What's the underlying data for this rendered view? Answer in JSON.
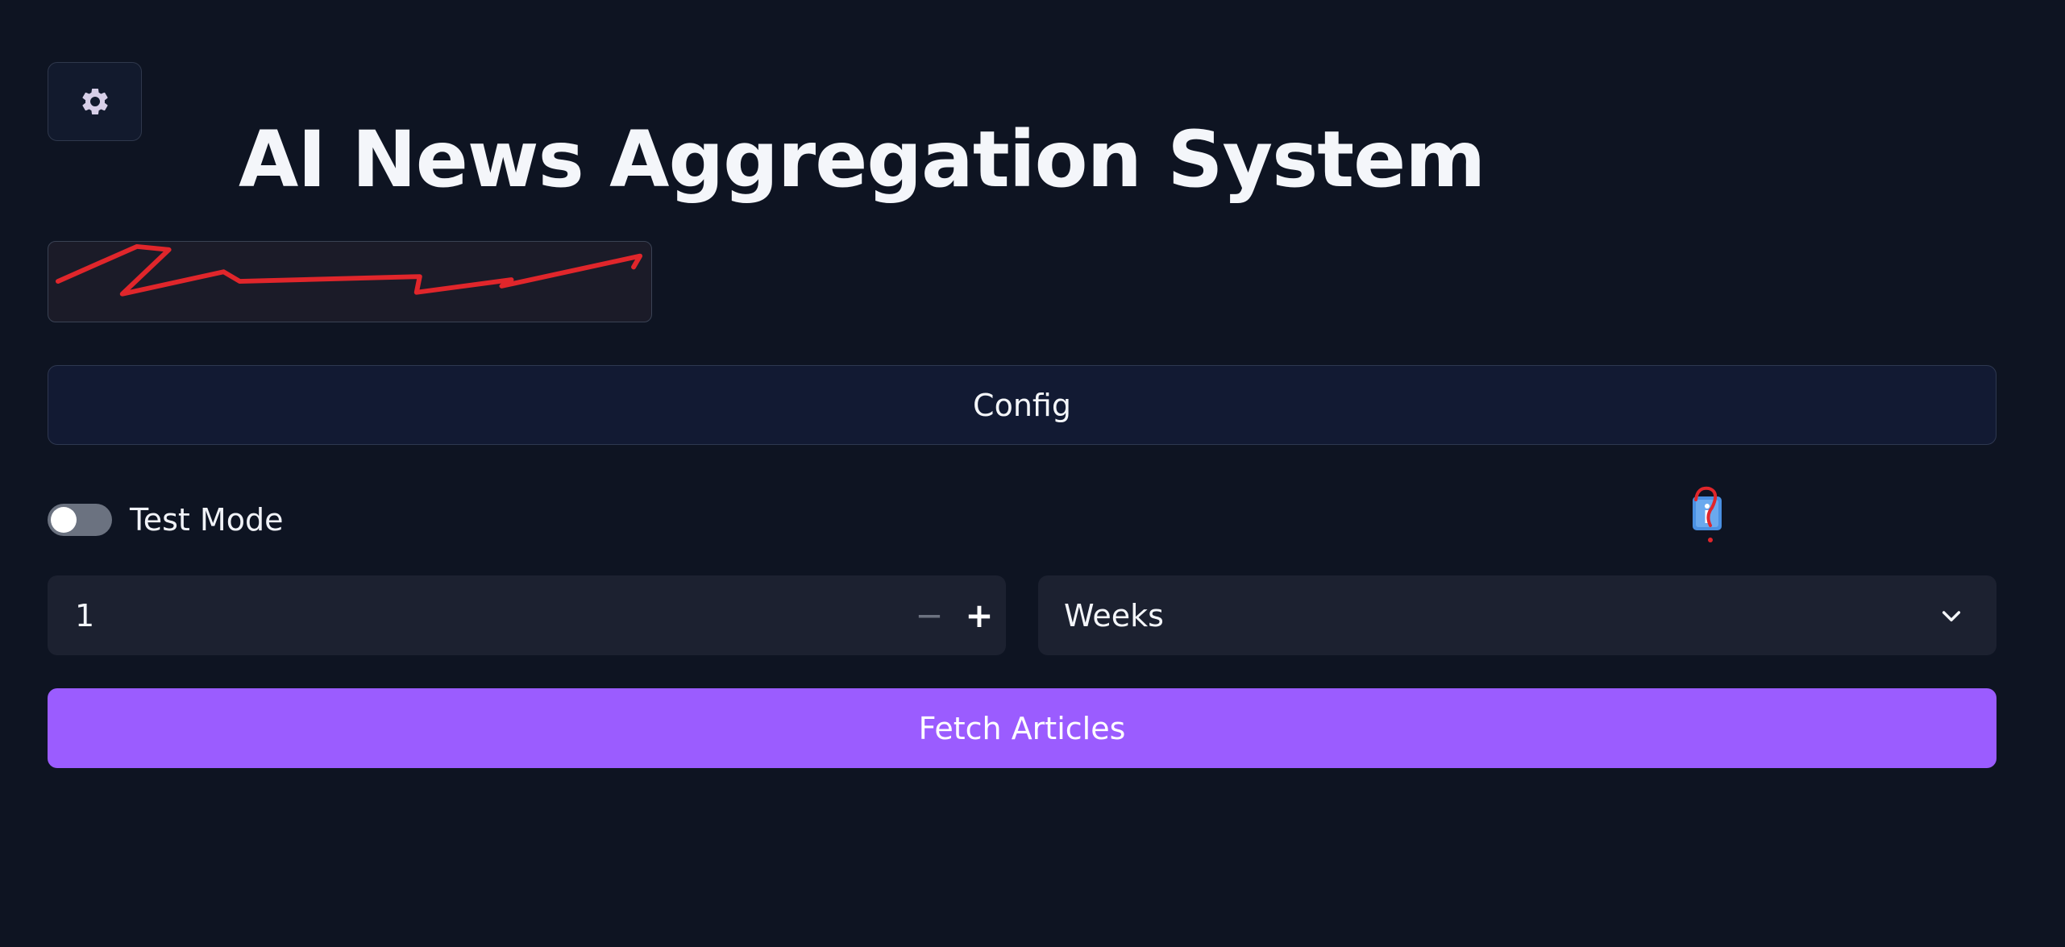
{
  "app": {
    "title": "AI News Aggregation System"
  },
  "icons": {
    "settings": "gear-icon",
    "info": "info-icon",
    "select_arrow": "chevron-down-icon"
  },
  "config_button": {
    "label": "Config"
  },
  "test_mode": {
    "label": "Test Mode",
    "enabled": false
  },
  "duration": {
    "value": "1",
    "minus_label": "−",
    "plus_label": "+"
  },
  "unit_select": {
    "selected": "Weeks"
  },
  "fetch_button": {
    "label": "Fetch Articles"
  },
  "colors": {
    "background": "#0e1422",
    "accent": "#9b5cff",
    "annotation": "#e0262b",
    "toggle_off": "#6b7280"
  }
}
